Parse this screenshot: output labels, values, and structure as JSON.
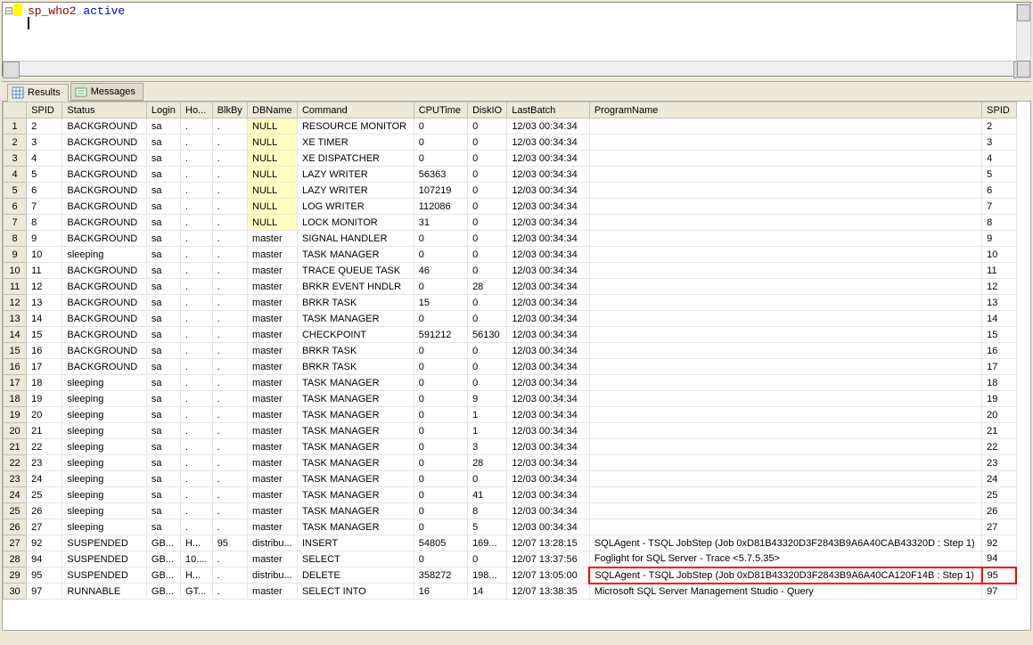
{
  "editor": {
    "line1_a": "sp_who2",
    "line1_b": " active"
  },
  "tabs": {
    "results": "Results",
    "messages": "Messages"
  },
  "columns": [
    "",
    "SPID",
    "Status",
    "Login",
    "Ho...",
    "BlkBy",
    "DBName",
    "Command",
    "CPUTime",
    "DiskIO",
    "LastBatch",
    "ProgramName",
    "SPID"
  ],
  "rows": [
    {
      "n": "1",
      "spid": "2",
      "status": "BACKGROUND",
      "login": "sa",
      "host": ".",
      "blk": ".",
      "db": "NULL",
      "cmd": "RESOURCE MONITOR",
      "cpu": "0",
      "disk": "0",
      "last": "12/03 00:34:34",
      "prog": "",
      "spid2": "2",
      "dbnull": true
    },
    {
      "n": "2",
      "spid": "3",
      "status": "BACKGROUND",
      "login": "sa",
      "host": ".",
      "blk": ".",
      "db": "NULL",
      "cmd": "XE TIMER",
      "cpu": "0",
      "disk": "0",
      "last": "12/03 00:34:34",
      "prog": "",
      "spid2": "3",
      "dbnull": true
    },
    {
      "n": "3",
      "spid": "4",
      "status": "BACKGROUND",
      "login": "sa",
      "host": ".",
      "blk": ".",
      "db": "NULL",
      "cmd": "XE DISPATCHER",
      "cpu": "0",
      "disk": "0",
      "last": "12/03 00:34:34",
      "prog": "",
      "spid2": "4",
      "dbnull": true
    },
    {
      "n": "4",
      "spid": "5",
      "status": "BACKGROUND",
      "login": "sa",
      "host": ".",
      "blk": ".",
      "db": "NULL",
      "cmd": "LAZY WRITER",
      "cpu": "56363",
      "disk": "0",
      "last": "12/03 00:34:34",
      "prog": "",
      "spid2": "5",
      "dbnull": true
    },
    {
      "n": "5",
      "spid": "6",
      "status": "BACKGROUND",
      "login": "sa",
      "host": ".",
      "blk": ".",
      "db": "NULL",
      "cmd": "LAZY WRITER",
      "cpu": "107219",
      "disk": "0",
      "last": "12/03 00:34:34",
      "prog": "",
      "spid2": "6",
      "dbnull": true
    },
    {
      "n": "6",
      "spid": "7",
      "status": "BACKGROUND",
      "login": "sa",
      "host": ".",
      "blk": ".",
      "db": "NULL",
      "cmd": "LOG WRITER",
      "cpu": "112086",
      "disk": "0",
      "last": "12/03 00:34:34",
      "prog": "",
      "spid2": "7",
      "dbnull": true
    },
    {
      "n": "7",
      "spid": "8",
      "status": "BACKGROUND",
      "login": "sa",
      "host": ".",
      "blk": ".",
      "db": "NULL",
      "cmd": "LOCK MONITOR",
      "cpu": "31",
      "disk": "0",
      "last": "12/03 00:34:34",
      "prog": "",
      "spid2": "8",
      "dbnull": true
    },
    {
      "n": "8",
      "spid": "9",
      "status": "BACKGROUND",
      "login": "sa",
      "host": ".",
      "blk": ".",
      "db": "master",
      "cmd": "SIGNAL HANDLER",
      "cpu": "0",
      "disk": "0",
      "last": "12/03 00:34:34",
      "prog": "",
      "spid2": "9"
    },
    {
      "n": "9",
      "spid": "10",
      "status": "sleeping",
      "login": "sa",
      "host": ".",
      "blk": ".",
      "db": "master",
      "cmd": "TASK MANAGER",
      "cpu": "0",
      "disk": "0",
      "last": "12/03 00:34:34",
      "prog": "",
      "spid2": "10"
    },
    {
      "n": "10",
      "spid": "11",
      "status": "BACKGROUND",
      "login": "sa",
      "host": ".",
      "blk": ".",
      "db": "master",
      "cmd": "TRACE QUEUE TASK",
      "cpu": "46",
      "disk": "0",
      "last": "12/03 00:34:34",
      "prog": "",
      "spid2": "11"
    },
    {
      "n": "11",
      "spid": "12",
      "status": "BACKGROUND",
      "login": "sa",
      "host": ".",
      "blk": ".",
      "db": "master",
      "cmd": "BRKR EVENT HNDLR",
      "cpu": "0",
      "disk": "28",
      "last": "12/03 00:34:34",
      "prog": "",
      "spid2": "12"
    },
    {
      "n": "12",
      "spid": "13",
      "status": "BACKGROUND",
      "login": "sa",
      "host": ".",
      "blk": ".",
      "db": "master",
      "cmd": "BRKR TASK",
      "cpu": "15",
      "disk": "0",
      "last": "12/03 00:34:34",
      "prog": "",
      "spid2": "13"
    },
    {
      "n": "13",
      "spid": "14",
      "status": "BACKGROUND",
      "login": "sa",
      "host": ".",
      "blk": ".",
      "db": "master",
      "cmd": "TASK MANAGER",
      "cpu": "0",
      "disk": "0",
      "last": "12/03 00:34:34",
      "prog": "",
      "spid2": "14"
    },
    {
      "n": "14",
      "spid": "15",
      "status": "BACKGROUND",
      "login": "sa",
      "host": ".",
      "blk": ".",
      "db": "master",
      "cmd": "CHECKPOINT",
      "cpu": "591212",
      "disk": "56130",
      "last": "12/03 00:34:34",
      "prog": "",
      "spid2": "15"
    },
    {
      "n": "15",
      "spid": "16",
      "status": "BACKGROUND",
      "login": "sa",
      "host": ".",
      "blk": ".",
      "db": "master",
      "cmd": "BRKR TASK",
      "cpu": "0",
      "disk": "0",
      "last": "12/03 00:34:34",
      "prog": "",
      "spid2": "16"
    },
    {
      "n": "16",
      "spid": "17",
      "status": "BACKGROUND",
      "login": "sa",
      "host": ".",
      "blk": ".",
      "db": "master",
      "cmd": "BRKR TASK",
      "cpu": "0",
      "disk": "0",
      "last": "12/03 00:34:34",
      "prog": "",
      "spid2": "17"
    },
    {
      "n": "17",
      "spid": "18",
      "status": "sleeping",
      "login": "sa",
      "host": ".",
      "blk": ".",
      "db": "master",
      "cmd": "TASK MANAGER",
      "cpu": "0",
      "disk": "0",
      "last": "12/03 00:34:34",
      "prog": "",
      "spid2": "18"
    },
    {
      "n": "18",
      "spid": "19",
      "status": "sleeping",
      "login": "sa",
      "host": ".",
      "blk": ".",
      "db": "master",
      "cmd": "TASK MANAGER",
      "cpu": "0",
      "disk": "9",
      "last": "12/03 00:34:34",
      "prog": "",
      "spid2": "19"
    },
    {
      "n": "19",
      "spid": "20",
      "status": "sleeping",
      "login": "sa",
      "host": ".",
      "blk": ".",
      "db": "master",
      "cmd": "TASK MANAGER",
      "cpu": "0",
      "disk": "1",
      "last": "12/03 00:34:34",
      "prog": "",
      "spid2": "20"
    },
    {
      "n": "20",
      "spid": "21",
      "status": "sleeping",
      "login": "sa",
      "host": ".",
      "blk": ".",
      "db": "master",
      "cmd": "TASK MANAGER",
      "cpu": "0",
      "disk": "1",
      "last": "12/03 00:34:34",
      "prog": "",
      "spid2": "21"
    },
    {
      "n": "21",
      "spid": "22",
      "status": "sleeping",
      "login": "sa",
      "host": ".",
      "blk": ".",
      "db": "master",
      "cmd": "TASK MANAGER",
      "cpu": "0",
      "disk": "3",
      "last": "12/03 00:34:34",
      "prog": "",
      "spid2": "22"
    },
    {
      "n": "22",
      "spid": "23",
      "status": "sleeping",
      "login": "sa",
      "host": ".",
      "blk": ".",
      "db": "master",
      "cmd": "TASK MANAGER",
      "cpu": "0",
      "disk": "28",
      "last": "12/03 00:34:34",
      "prog": "",
      "spid2": "23"
    },
    {
      "n": "23",
      "spid": "24",
      "status": "sleeping",
      "login": "sa",
      "host": ".",
      "blk": ".",
      "db": "master",
      "cmd": "TASK MANAGER",
      "cpu": "0",
      "disk": "0",
      "last": "12/03 00:34:34",
      "prog": "",
      "spid2": "24"
    },
    {
      "n": "24",
      "spid": "25",
      "status": "sleeping",
      "login": "sa",
      "host": ".",
      "blk": ".",
      "db": "master",
      "cmd": "TASK MANAGER",
      "cpu": "0",
      "disk": "41",
      "last": "12/03 00:34:34",
      "prog": "",
      "spid2": "25"
    },
    {
      "n": "25",
      "spid": "26",
      "status": "sleeping",
      "login": "sa",
      "host": ".",
      "blk": ".",
      "db": "master",
      "cmd": "TASK MANAGER",
      "cpu": "0",
      "disk": "8",
      "last": "12/03 00:34:34",
      "prog": "",
      "spid2": "26"
    },
    {
      "n": "26",
      "spid": "27",
      "status": "sleeping",
      "login": "sa",
      "host": ".",
      "blk": ".",
      "db": "master",
      "cmd": "TASK MANAGER",
      "cpu": "0",
      "disk": "5",
      "last": "12/03 00:34:34",
      "prog": "",
      "spid2": "27"
    },
    {
      "n": "27",
      "spid": "92",
      "status": "SUSPENDED",
      "login": "GB...",
      "host": "H...",
      "blk": "95",
      "db": "distribu...",
      "cmd": "INSERT",
      "cpu": "54805",
      "disk": "169...",
      "last": "12/07 13:28:15",
      "prog": "SQLAgent - TSQL JobStep (Job 0xD81B43320D3F2843B9A6A40CAB43320D : Step 1)",
      "spid2": "92"
    },
    {
      "n": "28",
      "spid": "94",
      "status": "SUSPENDED",
      "login": "GB...",
      "host": "10....",
      "blk": ".",
      "db": "master",
      "cmd": "SELECT",
      "cpu": "0",
      "disk": "0",
      "last": "12/07 13:37:56",
      "prog": "Foglight for SQL Server - Trace <5.7.5.35>",
      "spid2": "94"
    },
    {
      "n": "29",
      "spid": "95",
      "status": "SUSPENDED",
      "login": "GB...",
      "host": "H...",
      "blk": ".",
      "db": "distribu...",
      "cmd": "DELETE",
      "cpu": "358272",
      "disk": "198...",
      "last": "12/07 13:05:00",
      "prog": "SQLAgent - TSQL JobStep (Job 0xD81B43320D3F2843B9A6A40CA120F14B : Step 1)",
      "spid2": "95",
      "highlight": true
    },
    {
      "n": "30",
      "spid": "97",
      "status": "RUNNABLE",
      "login": "GB...",
      "host": "GT...",
      "blk": ".",
      "db": "master",
      "cmd": "SELECT INTO",
      "cpu": "16",
      "disk": "14",
      "last": "12/07 13:38:35",
      "prog": "Microsoft SQL Server Management Studio - Query",
      "spid2": "97"
    }
  ]
}
